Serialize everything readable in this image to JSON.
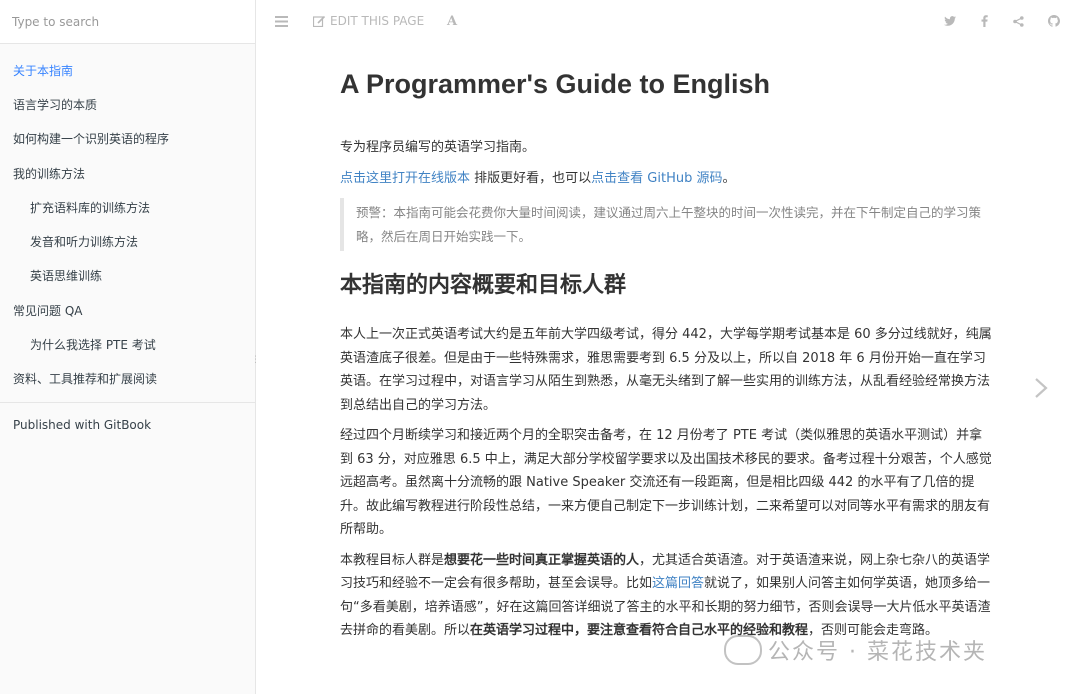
{
  "search": {
    "placeholder": "Type to search"
  },
  "sidebar": {
    "items": [
      {
        "label": "关于本指南"
      },
      {
        "label": "语言学习的本质"
      },
      {
        "label": "如何构建一个识别英语的程序"
      },
      {
        "label": "我的训练方法"
      },
      {
        "label": "扩充语料库的训练方法"
      },
      {
        "label": "发音和听力训练方法"
      },
      {
        "label": "英语思维训练"
      },
      {
        "label": "常见问题 QA"
      },
      {
        "label": "为什么我选择 PTE 考试"
      },
      {
        "label": "资料、工具推荐和扩展阅读"
      }
    ],
    "published": "Published with GitBook"
  },
  "toolbar": {
    "edit_label": "EDIT THIS PAGE",
    "font_label": "A",
    "icons": [
      "menu-icon",
      "edit-icon",
      "font-settings-icon",
      "twitter-icon",
      "facebook-icon",
      "share-icon",
      "github-icon"
    ]
  },
  "page": {
    "title": "A Programmer's Guide to English",
    "intro": "专为程序员编写的英语学习指南。",
    "online_link": "点击这里打开在线版本",
    "online_mid": " 排版更好看，也可以",
    "github_link": "点击查看 GitHub 源码",
    "online_end": "。",
    "warning": "预警：本指南可能会花费你大量时间阅读，建议通过周六上午整块的时间一次性读完，并在下午制定自己的学习策略，然后在周日开始实践一下。",
    "section_title": "本指南的内容概要和目标人群",
    "para1": "本人上一次正式英语考试大约是五年前大学四级考试，得分 442，大学每学期考试基本是 60 多分过线就好，纯属英语渣底子很差。但是由于一些特殊需求，雅思需要考到 6.5 分及以上，所以自 2018 年 6 月份开始一直在学习英语。在学习过程中，对语言学习从陌生到熟悉，从毫无头绪到了解一些实用的训练方法，从乱看经验经常换方法到总结出自己的学习方法。",
    "para2": "经过四个月断续学习和接近两个月的全职突击备考，在 12 月份考了 PTE 考试（类似雅思的英语水平测试）并拿到 63 分，对应雅思 6.5 中上，满足大部分学校留学要求以及出国技术移民的要求。备考过程十分艰苦，个人感觉远超高考。虽然离十分流畅的跟 Native Speaker 交流还有一段距离，但是相比四级 442 的水平有了几倍的提升。故此编写教程进行阶段性总结，一来方便自己制定下一步训练计划，二来希望可以对同等水平有需求的朋友有所帮助。",
    "para3_a": "本教程目标人群是",
    "para3_b": "想要花一些时间真正掌握英语的人",
    "para3_c": "，尤其适合英语渣。对于英语渣来说，网上杂七杂八的英语学习技巧和经验不一定会有很多帮助，甚至会误导。比如",
    "para3_link": "这篇回答",
    "para3_d": "就说了，如果别人问答主如何学英语，她顶多给一句“多看美剧，培养语感”，好在这篇回答详细说了答主的水平和长期的努力细节，否则会误导一大片低水平英语渣去拼命的看美剧。所以",
    "para3_e": "在英语学习过程中，要注意查看符合自己水平的经验和教程",
    "para3_f": "，否则可能会走弯路。"
  },
  "watermark": {
    "text": "公众号 · 菜花技术夹"
  }
}
